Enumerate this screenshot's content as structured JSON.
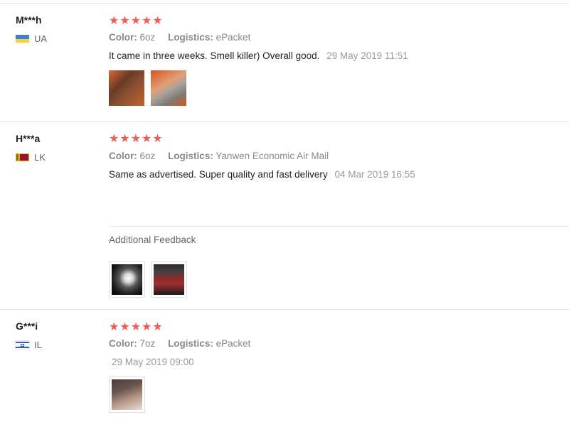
{
  "reviews": [
    {
      "user": "M***h",
      "country": "UA",
      "rating": "★★★★★",
      "color_label": "Color:",
      "color_value": "6oz",
      "logistics_label": "Logistics:",
      "logistics_value": "ePacket",
      "text": "It came in three weeks. Smell killer) Overall good.",
      "date": "29 May 2019 11:51",
      "photos": [
        "flask-brown-photo",
        "flask-side-photo"
      ]
    },
    {
      "user": "H***a",
      "country": "LK",
      "rating": "★★★★★",
      "color_label": "Color:",
      "color_value": "6oz",
      "logistics_label": "Logistics:",
      "logistics_value": "Yanwen Economic Air Mail",
      "text": "Same as advertised. Super quality and fast delivery",
      "date": "04 Mar 2019 16:55",
      "additional_label": "Additional Feedback",
      "additional_photos": [
        "flask-dark-photo",
        "flask-red-photo"
      ]
    },
    {
      "user": "G***i",
      "country": "IL",
      "rating": "★★★★★",
      "color_label": "Color:",
      "color_value": "7oz",
      "logistics_label": "Logistics:",
      "logistics_value": "ePacket",
      "date": "29 May 2019 09:00",
      "photos": [
        "flask-hand-photo"
      ]
    }
  ],
  "colors": {
    "star": "#f25c54",
    "divider": "#e6e6e6",
    "muted": "#888888"
  }
}
